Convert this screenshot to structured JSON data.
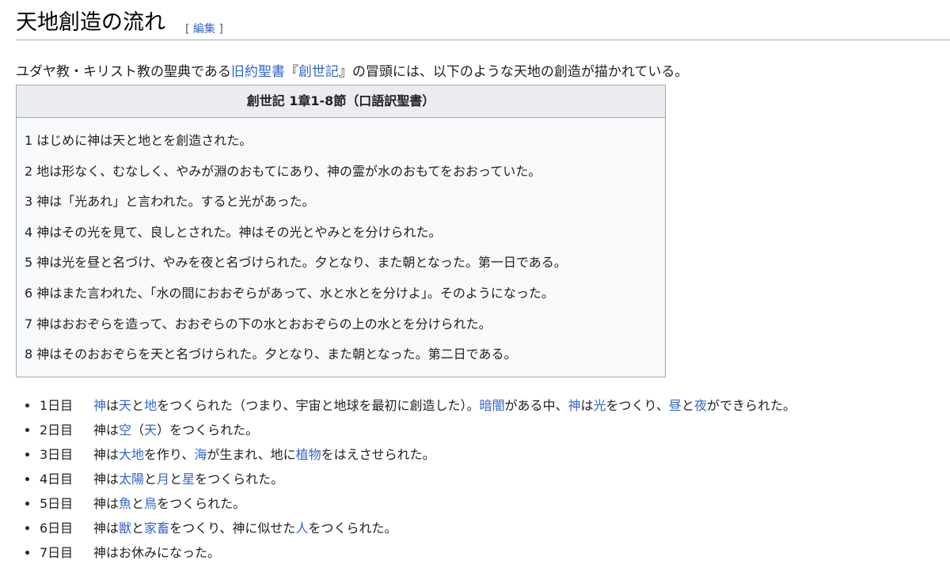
{
  "section": {
    "title": "天地創造の流れ",
    "edit_open": "[",
    "edit_label": "編集",
    "edit_close": "]"
  },
  "intro": [
    {
      "text": "ユダヤ教・キリスト教の聖典である"
    },
    {
      "text": "旧約聖書",
      "link": true
    },
    {
      "text": "『"
    },
    {
      "text": "創世記",
      "link": true
    },
    {
      "text": "』の冒頭には、以下のような天地の創造が描かれている。"
    }
  ],
  "quote": {
    "title": "創世記 1章1-8節（口語訳聖書）",
    "verses": [
      "1 はじめに神は天と地とを創造された。",
      "2 地は形なく、むなしく、やみが淵のおもてにあり、神の霊が水のおもてをおおっていた。",
      "3 神は「光あれ」と言われた。すると光があった。",
      "4 神はその光を見て、良しとされた。神はその光とやみとを分けられた。",
      "5 神は光を昼と名づけ、やみを夜と名づけられた。夕となり、また朝となった。第一日である。",
      "6 神はまた言われた、「水の間におおぞらがあって、水と水とを分けよ」。そのようになった。",
      "7 神はおおぞらを造って、おおぞらの下の水とおおぞらの上の水とを分けられた。",
      "8 神はそのおおぞらを天と名づけられた。夕となり、また朝となった。第二日である。"
    ]
  },
  "days": [
    {
      "label": "1日目",
      "parts": [
        {
          "text": "神",
          "link": true
        },
        {
          "text": "は"
        },
        {
          "text": "天",
          "link": true
        },
        {
          "text": "と"
        },
        {
          "text": "地",
          "link": true
        },
        {
          "text": "をつくられた（つまり、宇宙と地球を最初に創造した）。"
        },
        {
          "text": "暗闇",
          "link": true
        },
        {
          "text": "がある中、"
        },
        {
          "text": "神",
          "link": true
        },
        {
          "text": "は"
        },
        {
          "text": "光",
          "link": true
        },
        {
          "text": "をつくり、"
        },
        {
          "text": "昼",
          "link": true
        },
        {
          "text": "と"
        },
        {
          "text": "夜",
          "link": true
        },
        {
          "text": "ができられた。"
        }
      ]
    },
    {
      "label": "2日目",
      "parts": [
        {
          "text": "神は"
        },
        {
          "text": "空",
          "link": true
        },
        {
          "text": "（"
        },
        {
          "text": "天",
          "link": true
        },
        {
          "text": "）をつくられた。"
        }
      ]
    },
    {
      "label": "3日目",
      "parts": [
        {
          "text": "神は"
        },
        {
          "text": "大地",
          "link": true
        },
        {
          "text": "を作り、"
        },
        {
          "text": "海",
          "link": true
        },
        {
          "text": "が生まれ、地に"
        },
        {
          "text": "植物",
          "link": true
        },
        {
          "text": "をはえさせられた。"
        }
      ]
    },
    {
      "label": "4日目",
      "parts": [
        {
          "text": "神は"
        },
        {
          "text": "太陽",
          "link": true
        },
        {
          "text": "と"
        },
        {
          "text": "月",
          "link": true
        },
        {
          "text": "と"
        },
        {
          "text": "星",
          "link": true
        },
        {
          "text": "をつくられた。"
        }
      ]
    },
    {
      "label": "5日目",
      "parts": [
        {
          "text": "神は"
        },
        {
          "text": "魚",
          "link": true
        },
        {
          "text": "と"
        },
        {
          "text": "鳥",
          "link": true
        },
        {
          "text": "をつくられた。"
        }
      ]
    },
    {
      "label": "6日目",
      "parts": [
        {
          "text": "神は"
        },
        {
          "text": "獣",
          "link": true
        },
        {
          "text": "と"
        },
        {
          "text": "家畜",
          "link": true
        },
        {
          "text": "をつくり、神に似せた"
        },
        {
          "text": "人",
          "link": true
        },
        {
          "text": "をつくられた。"
        }
      ]
    },
    {
      "label": "7日目",
      "parts": [
        {
          "text": "神はお休みになった。"
        }
      ]
    }
  ]
}
